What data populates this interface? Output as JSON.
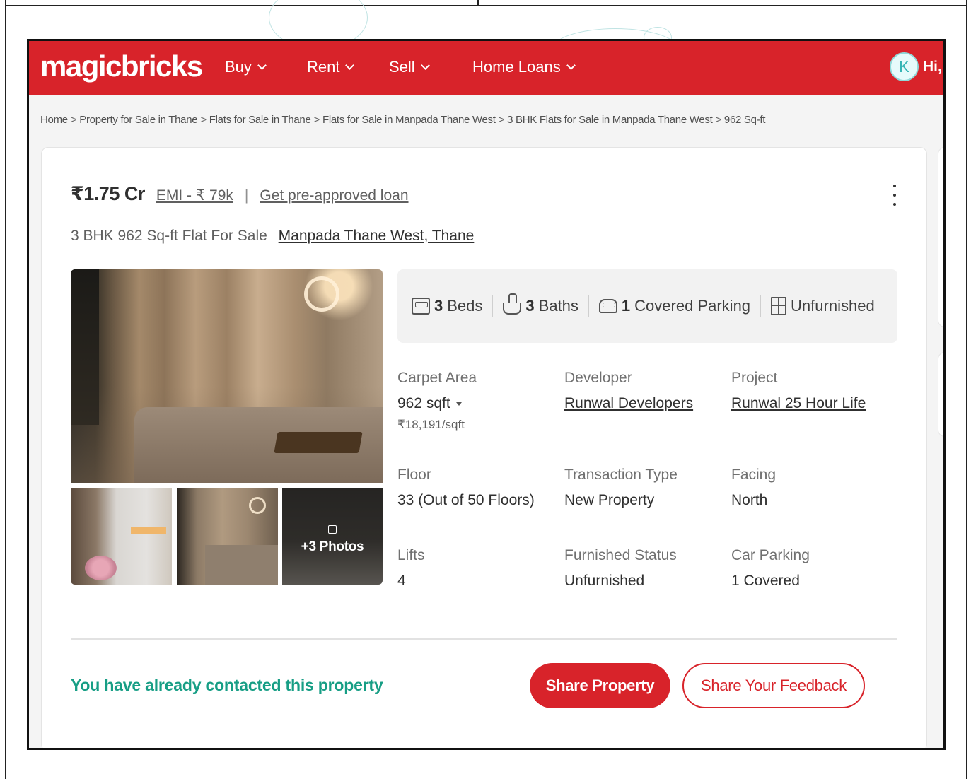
{
  "header": {
    "logo": "magicbricks",
    "nav": [
      {
        "label": "Buy"
      },
      {
        "label": "Rent"
      },
      {
        "label": "Sell"
      },
      {
        "label": "Home Loans"
      }
    ],
    "avatar_initial": "K",
    "greeting": "Hi, I"
  },
  "breadcrumb": [
    "Home",
    "Property for Sale in Thane",
    "Flats for Sale in Thane",
    "Flats for Sale in Manpada Thane West",
    "3 BHK Flats for Sale in Manpada Thane West",
    "962 Sq-ft"
  ],
  "listing": {
    "price": "₹1.75 Cr",
    "emi": "EMI - ₹ 79k",
    "separator": "|",
    "loan_link": "Get pre-approved loan",
    "title": "3 BHK 962 Sq-ft Flat For Sale",
    "location": "Manpada Thane West, Thane",
    "more_photos": "+3 Photos"
  },
  "features": [
    {
      "icon": "bed-icon",
      "num": "3",
      "label": "Beds"
    },
    {
      "icon": "bath-icon",
      "num": "3",
      "label": "Baths"
    },
    {
      "icon": "car-icon",
      "num": "1",
      "label": "Covered Parking"
    },
    {
      "icon": "furnishing-icon",
      "num": "",
      "label": "Unfurnished"
    }
  ],
  "details": {
    "carpet_area": {
      "label": "Carpet Area",
      "value": "962 sqft",
      "sub": "₹18,191/sqft"
    },
    "developer": {
      "label": "Developer",
      "value": "Runwal Developers"
    },
    "project": {
      "label": "Project",
      "value": "Runwal 25 Hour Life"
    },
    "floor": {
      "label": "Floor",
      "value": "33 (Out of 50 Floors)"
    },
    "transaction_type": {
      "label": "Transaction Type",
      "value": "New Property"
    },
    "facing": {
      "label": "Facing",
      "value": "North"
    },
    "lifts": {
      "label": "Lifts",
      "value": "4"
    },
    "furnished_status": {
      "label": "Furnished Status",
      "value": "Unfurnished"
    },
    "car_parking": {
      "label": "Car Parking",
      "value": "1 Covered"
    }
  },
  "footer": {
    "contacted_text": "You have already contacted this property",
    "share_button": "Share Property",
    "feedback_button": "Share Your Feedback"
  },
  "colors": {
    "brand_red": "#d8232a",
    "contacted_green": "#179e85"
  }
}
